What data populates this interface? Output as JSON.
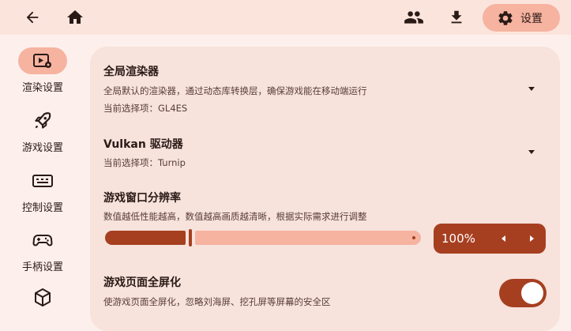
{
  "colors": {
    "accent": "#a63f20",
    "chip": "#f6b3a0",
    "topbar": "#fbe4dc",
    "card": "#f7e2dc",
    "background": "#fdf0ec"
  },
  "header": {
    "back_icon": "arrow-left-icon",
    "home_icon": "home-icon",
    "accounts_icon": "people-icon",
    "download_icon": "download-icon",
    "settings_icon": "gear-icon",
    "settings_label": "设置"
  },
  "sidebar": {
    "items": [
      {
        "label": "渲染设置",
        "icon": "render-video-gear-icon",
        "active": true
      },
      {
        "label": "游戏设置",
        "icon": "rocket-icon",
        "active": false
      },
      {
        "label": "控制设置",
        "icon": "keyboard-icon",
        "active": false
      },
      {
        "label": "手柄设置",
        "icon": "gamepad-icon",
        "active": false
      },
      {
        "label": "",
        "icon": "cube-icon",
        "active": false
      }
    ]
  },
  "settings": {
    "renderer": {
      "title": "全局渲染器",
      "desc": "全局默认的渲染器，通过动态库转换层，确保游戏能在移动端运行",
      "current": "当前选择项：GL4ES"
    },
    "vulkan": {
      "title": "Vulkan 驱动器",
      "current": "当前选择项：Turnip"
    },
    "resolution": {
      "title": "游戏窗口分辨率",
      "desc": "数值越低性能越高，数值越高画质越清晰，根据实际需求进行调整",
      "value_text": "100%",
      "slider_fraction": 0.27
    },
    "fullscreen": {
      "title": "游戏页面全屏化",
      "desc": "使游戏页面全屏化，忽略刘海屏、挖孔屏等屏幕的安全区",
      "enabled": true
    }
  }
}
